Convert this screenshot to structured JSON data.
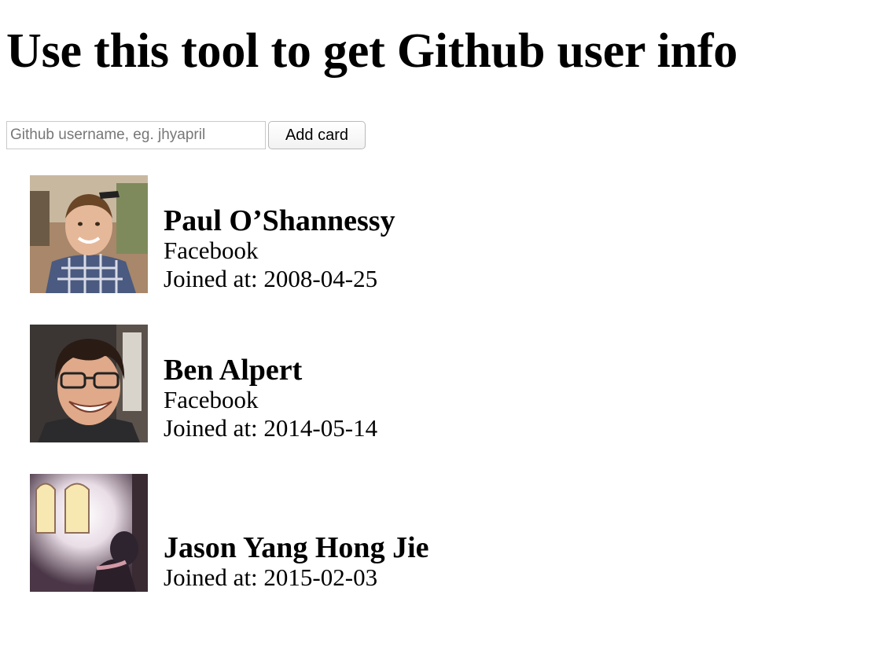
{
  "header": {
    "title": "Use this tool to get Github user info"
  },
  "form": {
    "input_value": "",
    "input_placeholder": "Github username, eg. jhyapril",
    "button_label": "Add card"
  },
  "cards": [
    {
      "name": "Paul O’Shannessy",
      "company": "Facebook",
      "joined": "Joined at: 2008-04-25",
      "avatar_icon": "avatar-photo"
    },
    {
      "name": "Ben Alpert",
      "company": "Facebook",
      "joined": "Joined at: 2014-05-14",
      "avatar_icon": "avatar-photo"
    },
    {
      "name": "Jason Yang Hong Jie",
      "joined": "Joined at: 2015-02-03",
      "avatar_icon": "avatar-photo"
    }
  ]
}
